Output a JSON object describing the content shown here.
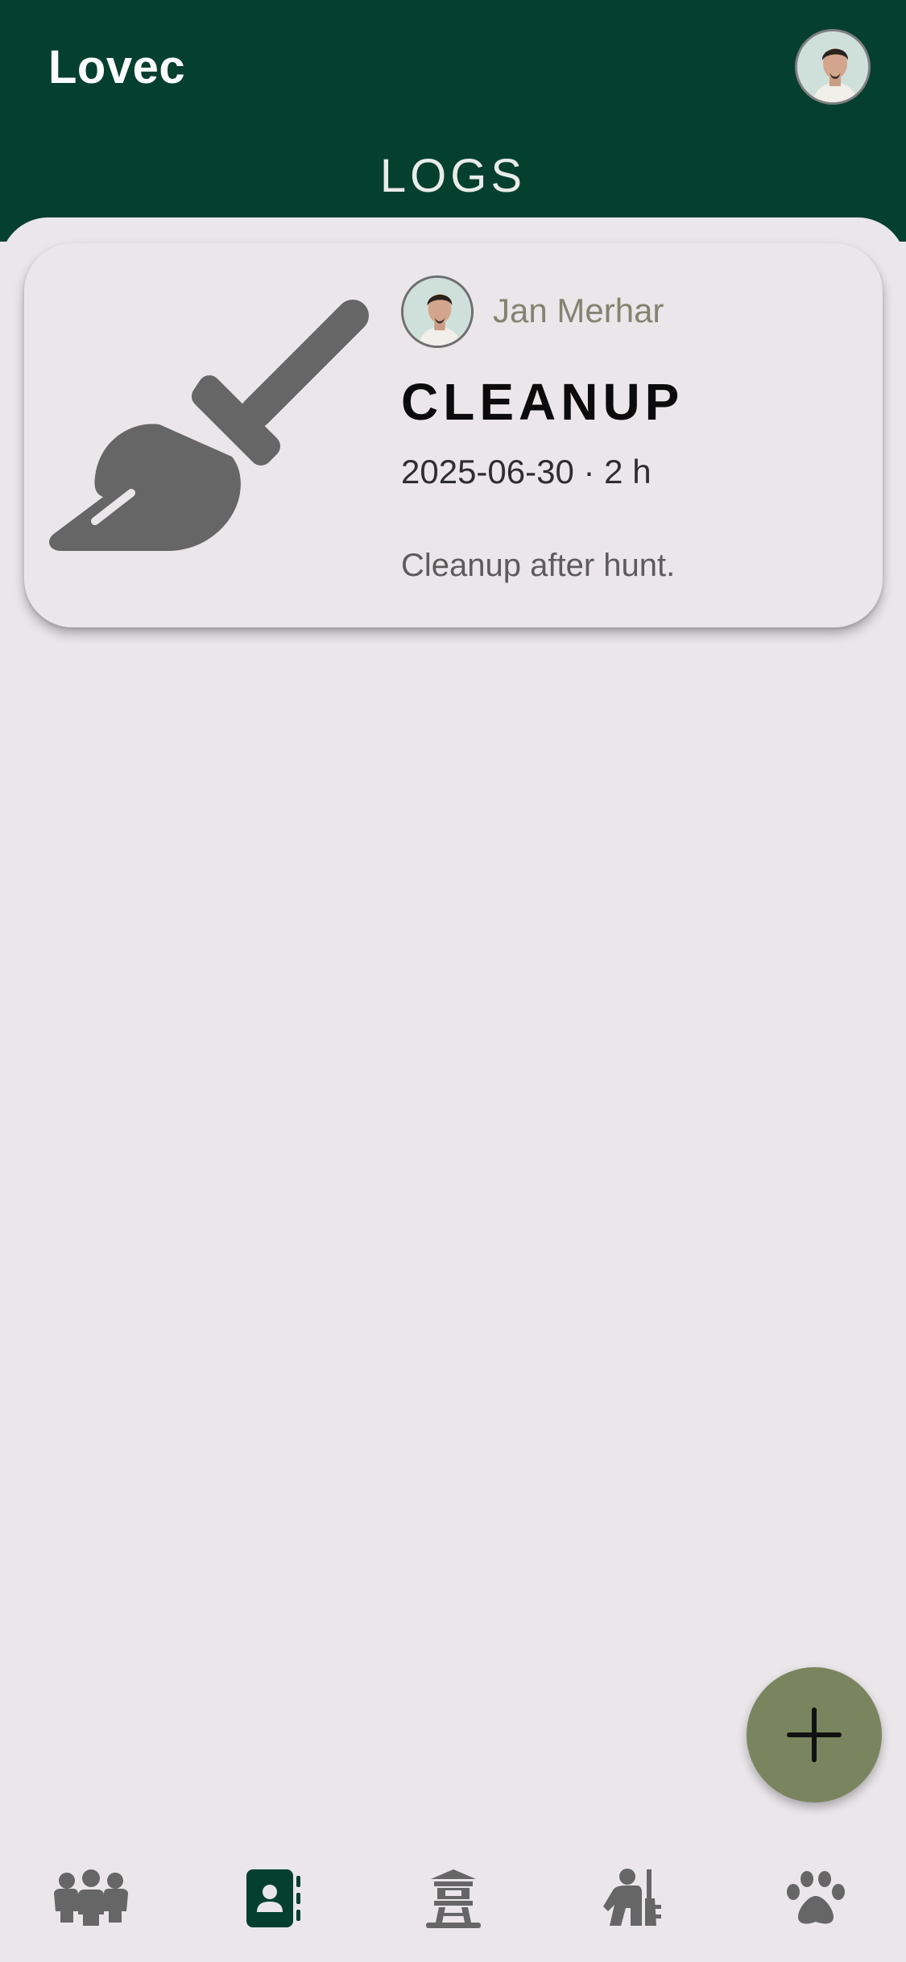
{
  "app": {
    "title": "Lovec"
  },
  "header": {
    "heading": "LOGS"
  },
  "log": {
    "owner_name": "Jan Merhar",
    "type": "CLEANUP",
    "meta": "2025-06-30 · 2 h",
    "description": "Cleanup after hunt.",
    "icon": "broom-icon"
  },
  "fab": {
    "icon": "plus-icon"
  },
  "bottom_nav": {
    "items": [
      {
        "icon": "group-icon",
        "active": false
      },
      {
        "icon": "contacts-book-icon",
        "active": true
      },
      {
        "icon": "hunting-tower-icon",
        "active": false
      },
      {
        "icon": "hunter-rifle-icon",
        "active": false
      },
      {
        "icon": "paw-icon",
        "active": false
      }
    ]
  },
  "colors": {
    "primary": "#05402e",
    "background": "#eae6ea",
    "fab": "#7a8560",
    "icon_gray": "#666666"
  }
}
